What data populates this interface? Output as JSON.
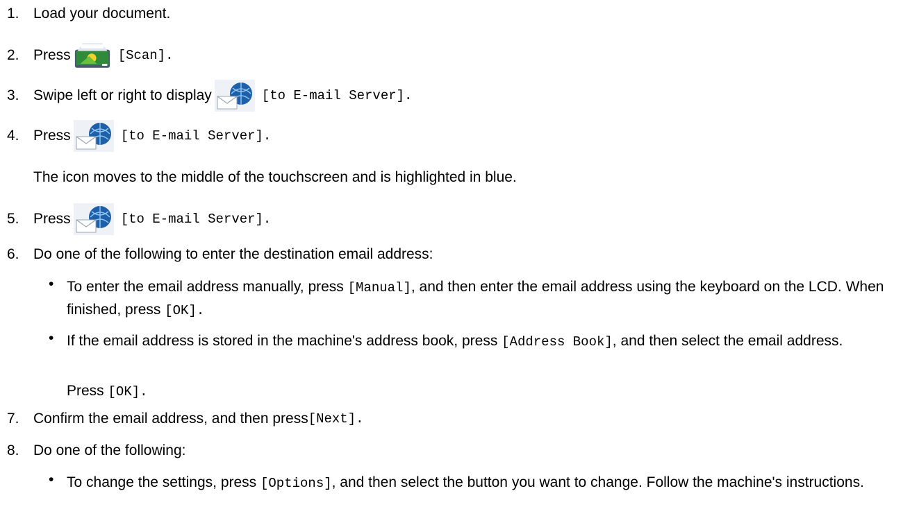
{
  "steps": [
    {
      "num": "1.",
      "text": "Load your document."
    },
    {
      "num": "2.",
      "pre": "Press",
      "icon": "scan-icon",
      "code": "[Scan]",
      "post": "."
    },
    {
      "num": "3.",
      "pre": "Swipe left or right to display",
      "icon": "email-server-icon",
      "code": "[to E-mail Server]",
      "post": "."
    },
    {
      "num": "4.",
      "pre": "Press",
      "icon": "email-server-icon",
      "code": "[to E-mail Server]",
      "post": ".",
      "note": "The icon moves to the middle of the touchscreen and is highlighted in blue."
    },
    {
      "num": "5.",
      "pre": "Press",
      "icon": "email-server-icon",
      "code": "[to E-mail Server]",
      "post": "."
    },
    {
      "num": "6.",
      "text": "Do one of the following to enter the destination email address:",
      "bullets": [
        {
          "t1": "To enter the email address manually, press ",
          "c1": "[Manual]",
          "t2": ", and then enter the email address using the keyboard on the LCD. When finished, press ",
          "c2": "[OK]",
          "t3": "."
        },
        {
          "t1": "If the email address is stored in the machine's address book, press ",
          "c1": "[Address Book]",
          "t2": ", and then select the email address.",
          "c2": "",
          "t3": "",
          "after_pre": "Press ",
          "after_code": "[OK]",
          "after_post": "."
        }
      ]
    },
    {
      "num": "7.",
      "t1": "Confirm the email address, and then press ",
      "c1": "[Next]",
      "t2": "."
    },
    {
      "num": "8.",
      "text": "Do one of the following:",
      "bullets": [
        {
          "t1": "To change the settings, press ",
          "c1": "[Options]",
          "t2": ", and then select the button you want to change. Follow the machine's instructions.",
          "c2": "",
          "t3": ""
        }
      ]
    }
  ],
  "bullet_char": "•"
}
